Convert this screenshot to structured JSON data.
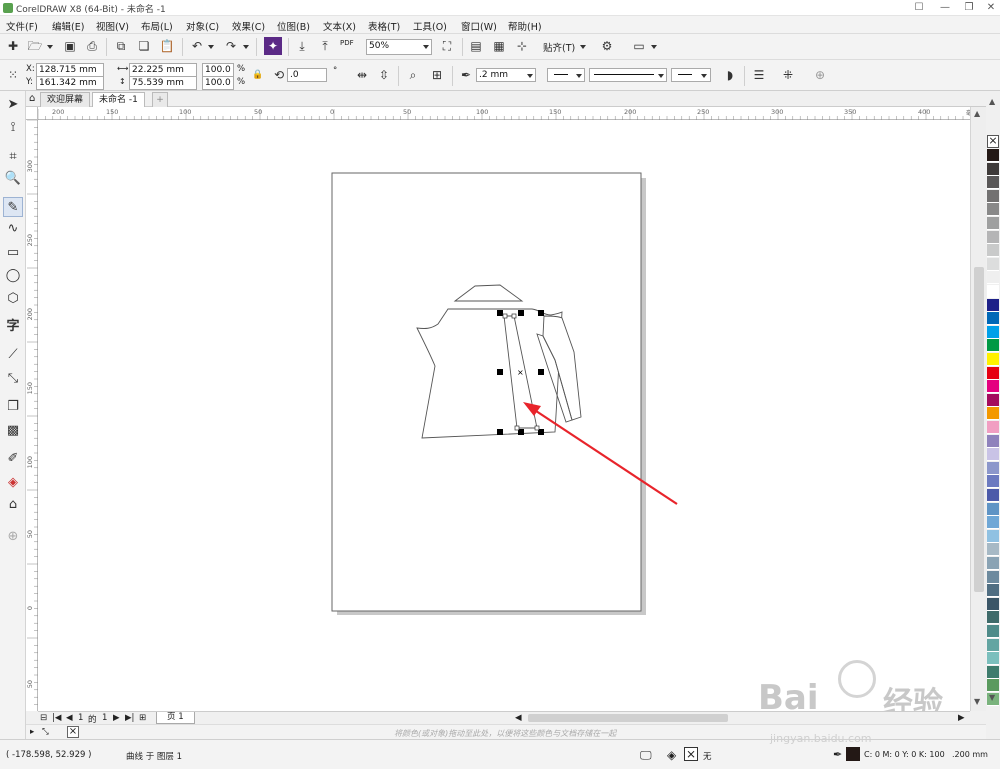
{
  "window": {
    "title": "CorelDRAW X8 (64-Bit) - 未命名 -1"
  },
  "menu": [
    "文件(F)",
    "编辑(E)",
    "视图(V)",
    "布局(L)",
    "对象(C)",
    "效果(C)",
    "位图(B)",
    "文本(X)",
    "表格(T)",
    "工具(O)",
    "窗口(W)",
    "帮助(H)"
  ],
  "toolbar": {
    "zoom": "50%",
    "snap_label": "贴齐(T)",
    "pdf_label": "PDF"
  },
  "properties": {
    "x": "128.715 mm",
    "y": "161.342 mm",
    "width": "22.225 mm",
    "height": "75.539 mm",
    "scale_x": "100.0",
    "scale_y": "100.0",
    "percent": "%",
    "rotation": ".0",
    "degree": "°",
    "outline_width": ".2 mm",
    "x_label": "X:",
    "y_label": "Y:"
  },
  "tabs": [
    {
      "label": "欢迎屏幕"
    },
    {
      "label": "未命名 -1"
    }
  ],
  "ruler": {
    "h_ticks": [
      "200",
      "150",
      "100",
      "50",
      "0",
      "50",
      "100",
      "150",
      "200",
      "250",
      "300",
      "350",
      "400"
    ],
    "v_ticks": [
      "300",
      "250",
      "200",
      "150",
      "100",
      "50",
      "0",
      "50"
    ],
    "unit": "毫米"
  },
  "pagebar": {
    "current": "1",
    "of": "的",
    "total": "1",
    "page_tab": "页 1"
  },
  "hint": "将颜色(或对象)拖动至此处，以便将这些颜色与文档存储在一起",
  "status": {
    "coords": "( -178.598, 52.929 )",
    "object": "曲线 于 图层 1",
    "fill_label": "无",
    "color_info": "C: 0 M: 0 Y: 0 K: 100",
    "outline": ".200 mm"
  },
  "palette_colors": [
    "#231815",
    "#3e3a39",
    "#595757",
    "#727171",
    "#898989",
    "#9fa0a0",
    "#b5b5b6",
    "#c9caca",
    "#dcdddd",
    "#efefef",
    "#ffffff",
    "#1d2088",
    "#0068b7",
    "#00a0e9",
    "#009944",
    "#fff100",
    "#e60012",
    "#e4007f",
    "#a40b5d",
    "#f39800",
    "#f19ec2",
    "#8f82bc",
    "#c9c3e6",
    "#8c97cb",
    "#6c7ac0",
    "#4c5aa9",
    "#5f94c5",
    "#6fa7d6",
    "#90c1e2",
    "#a7b9c5",
    "#8aa3b4",
    "#6d8a9e",
    "#506e82",
    "#3b5667",
    "#3f6b6a",
    "#4f8b89",
    "#63a5a2",
    "#7bbfbd",
    "#3e7c6d",
    "#5a9a5e",
    "#7ab37d"
  ],
  "watermark": {
    "brand": "Bai",
    "brand2": "经验",
    "url": "jingyan.baidu.com"
  }
}
